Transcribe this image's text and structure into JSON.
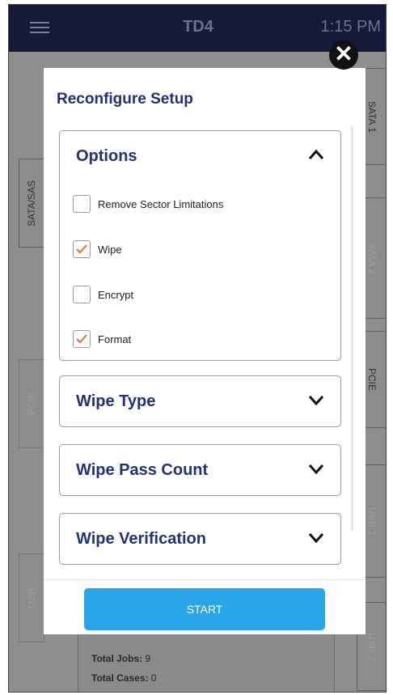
{
  "topbar": {
    "menu_icon": "hamburger-menu-icon",
    "title": "TD4",
    "time": "1:15 PM"
  },
  "background": {
    "tabs_right": [
      "SATA 1",
      "SATA 2",
      "PCIE",
      "USB 1",
      "USB 2"
    ],
    "tabs_left": [
      "SATA/SAS",
      "PCIE",
      "USB"
    ],
    "totals": {
      "jobs_label": "Total Jobs:",
      "jobs_value": " 9",
      "cases_label": "Total Cases:",
      "cases_value": " 0"
    }
  },
  "modal": {
    "title": "Reconfigure Setup",
    "close_icon": "close-icon",
    "options": {
      "title": "Options",
      "items": [
        {
          "label": "Remove Sector Limitations",
          "checked": false
        },
        {
          "label": "Wipe",
          "checked": true
        },
        {
          "label": "Encrypt",
          "checked": false
        },
        {
          "label": "Format",
          "checked": true
        }
      ]
    },
    "sections": [
      {
        "title": "Wipe Type"
      },
      {
        "title": "Wipe Pass Count"
      },
      {
        "title": "Wipe Verification"
      }
    ],
    "start_label": "START",
    "colors": {
      "accent": "#2aa5ea",
      "heading": "#233277",
      "check": "#f26b2a",
      "topbar": "#161a3a"
    }
  }
}
